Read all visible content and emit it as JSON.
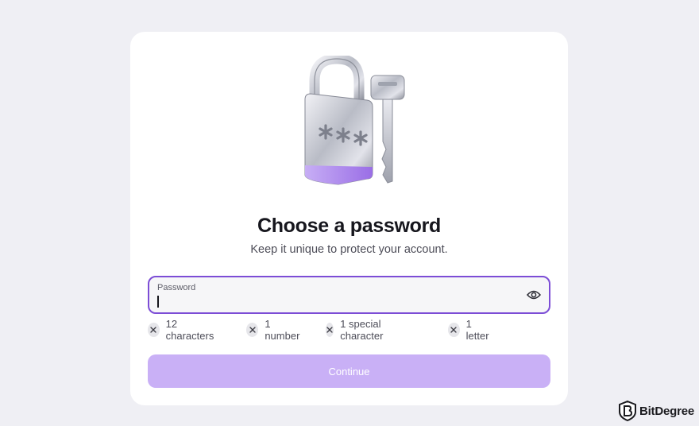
{
  "page": {
    "title": "Choose a password",
    "subtitle": "Keep it unique to protect your account."
  },
  "password_field": {
    "label": "Password",
    "value": "",
    "show_password_icon": "eye-icon"
  },
  "requirements": [
    {
      "label": "12 characters",
      "met": false,
      "icon": "close-icon"
    },
    {
      "label": "1 number",
      "met": false,
      "icon": "close-icon"
    },
    {
      "label": "1 special character",
      "met": false,
      "icon": "close-icon"
    },
    {
      "label": "1 letter",
      "met": false,
      "icon": "close-icon"
    }
  ],
  "continue_button": {
    "label": "Continue",
    "enabled": false
  },
  "illustration": {
    "icon": "padlock-with-key-icon",
    "padlock_text": "***"
  },
  "watermark": {
    "text": "BitDegree",
    "icon": "bitdegree-logo-icon"
  },
  "colors": {
    "background": "#efeff4",
    "card": "#ffffff",
    "accent": "#7c4dd6",
    "button_disabled": "#c9b0f6",
    "text_primary": "#16161d",
    "text_secondary": "#4d4d58"
  }
}
